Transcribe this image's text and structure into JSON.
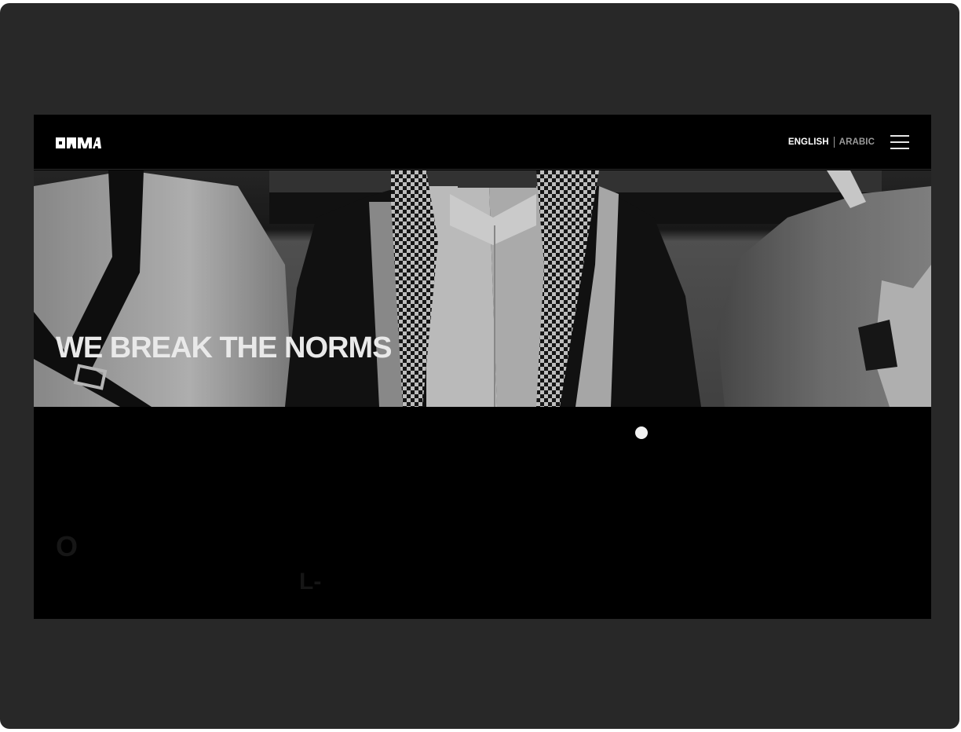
{
  "header": {
    "logo_icon": "brand-logo",
    "lang_active": "ENGLISH",
    "lang_inactive": "ARABIC",
    "menu_icon": "hamburger-menu-icon"
  },
  "hero": {
    "title": "WE BREAK THE NORMS"
  },
  "lower": {
    "indicator": "carousel-dot",
    "ghost_letters": [
      "O",
      "L-"
    ]
  }
}
